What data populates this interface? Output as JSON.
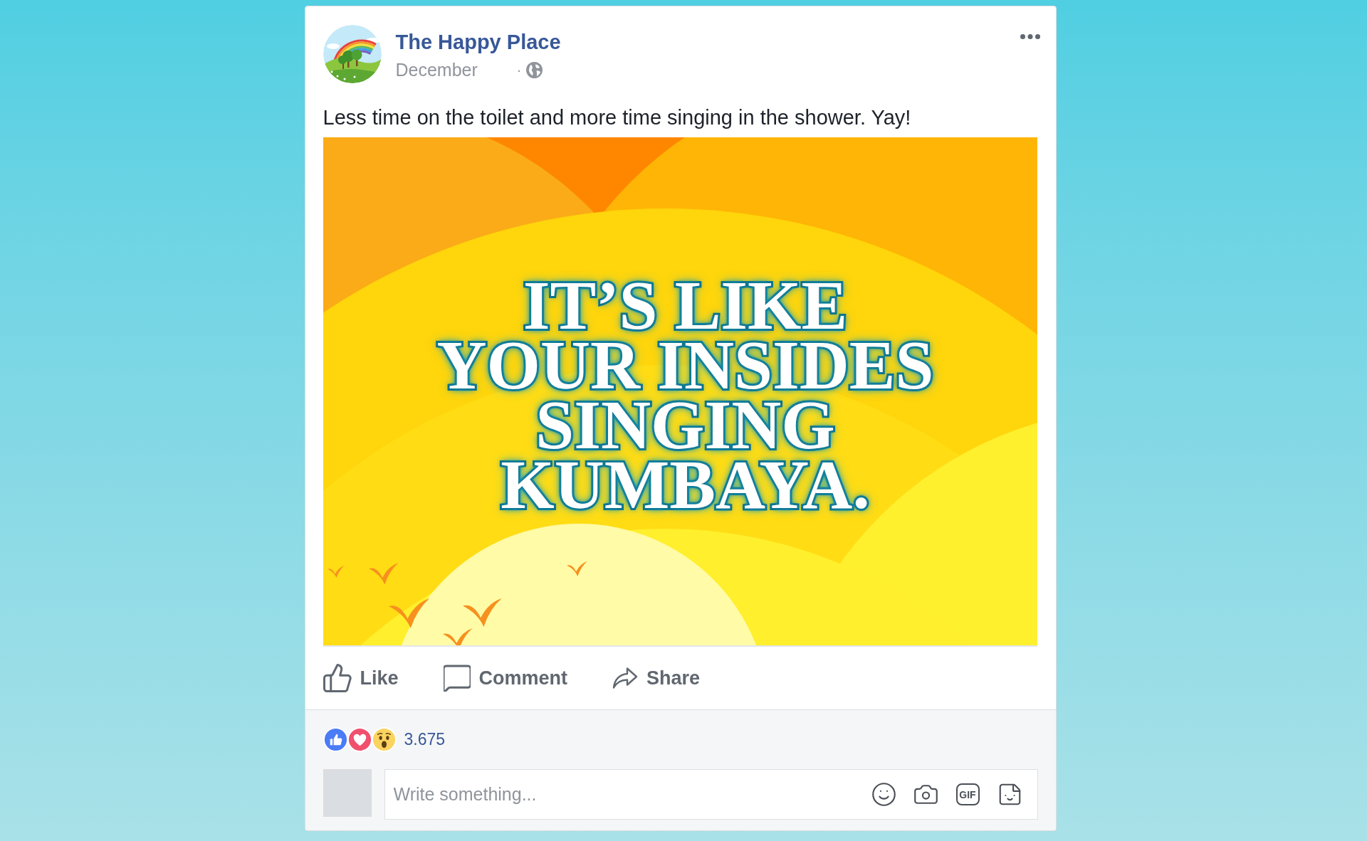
{
  "post": {
    "page_name": "The Happy Place",
    "date": "December",
    "separator": "·",
    "text": "Less time on the toilet and more time singing in the shower. Yay!",
    "image_text": [
      "IT’S LIKE",
      "YOUR INSIDES",
      "SINGING",
      "KUMBAYA."
    ]
  },
  "actions": [
    {
      "kind": "like",
      "label": "Like"
    },
    {
      "kind": "comment",
      "label": "Comment"
    },
    {
      "kind": "share",
      "label": "Share"
    }
  ],
  "reactions": {
    "types": [
      {
        "kind": "like"
      },
      {
        "kind": "love"
      },
      {
        "kind": "wow"
      }
    ],
    "count": "3.675"
  },
  "composer": {
    "placeholder": "Write something...",
    "tools": [
      {
        "kind": "emoji"
      },
      {
        "kind": "photo"
      },
      {
        "kind": "gif",
        "label": "GIF"
      },
      {
        "kind": "sticker"
      }
    ]
  }
}
